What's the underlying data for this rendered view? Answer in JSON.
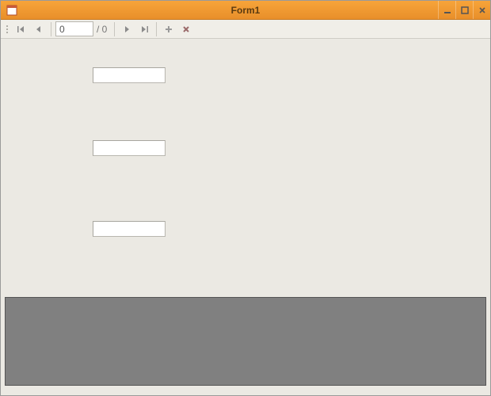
{
  "window": {
    "title": "Form1"
  },
  "navigator": {
    "position": "0",
    "total_label": "/ 0"
  },
  "fields": {
    "field1": "",
    "field2": "",
    "field3": ""
  }
}
